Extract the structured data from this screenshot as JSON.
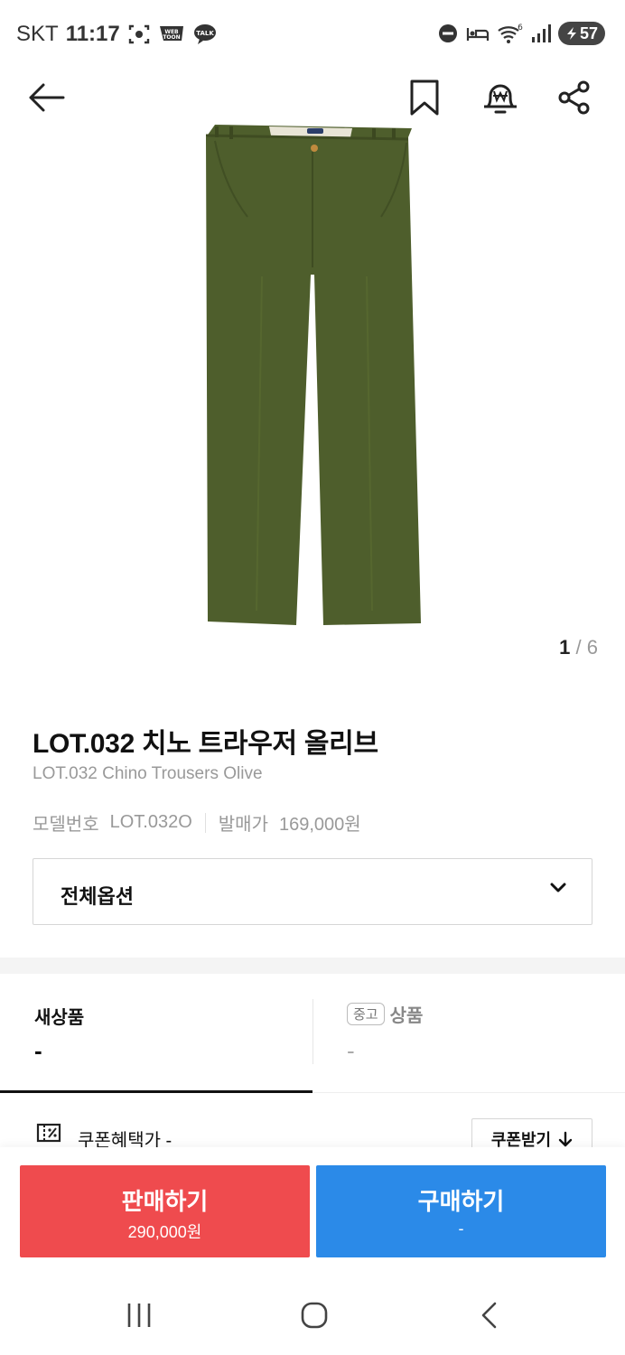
{
  "status_bar": {
    "carrier": "SKT",
    "time": "11:17",
    "webtoon_label": "WEB TOON",
    "talk_label": "TALK",
    "wifi_badge": "6",
    "battery": "57",
    "icons": [
      "screenshot-icon",
      "webtoon-icon",
      "kakaotalk-icon",
      "do-not-disturb-icon",
      "sleep-mode-icon",
      "wifi-icon",
      "signal-icon",
      "battery-icon"
    ]
  },
  "nav": {
    "icons": [
      "back-arrow-icon",
      "bookmark-icon",
      "price-alert-icon",
      "share-icon"
    ]
  },
  "gallery": {
    "current": "1",
    "separator": "/",
    "total": "6",
    "product_color": "#4e5e2c"
  },
  "product": {
    "name_ko": "LOT.032 치노 트라우저 올리브",
    "name_en": "LOT.032 Chino Trousers Olive",
    "model_label": "모델번호",
    "model_value": "LOT.032O",
    "release_label": "발매가",
    "release_value": "169,000원"
  },
  "options": {
    "label": "전체옵션"
  },
  "price_tabs": {
    "new_label": "새상품",
    "new_value": "-",
    "used_badge": "중고",
    "used_label": "상품",
    "used_value": "-"
  },
  "coupon": {
    "text": "쿠폰혜택가 -",
    "button_label": "쿠폰받기"
  },
  "actions": {
    "sell_label": "판매하기",
    "sell_price": "290,000원",
    "buy_label": "구매하기",
    "buy_price": "-",
    "sell_color": "#ef4b4e",
    "buy_color": "#2b8ae8"
  },
  "system_nav": {
    "icons": [
      "recent-apps-icon",
      "home-icon",
      "system-back-icon"
    ]
  }
}
